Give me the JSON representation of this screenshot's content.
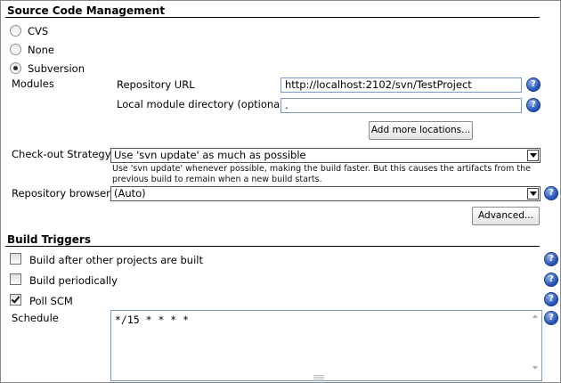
{
  "scm": {
    "title": "Source Code Management",
    "options": [
      {
        "label": "CVS",
        "checked": false
      },
      {
        "label": "None",
        "checked": false
      },
      {
        "label": "Subversion",
        "checked": true
      }
    ],
    "modules_label": "Modules",
    "repo_url_label": "Repository URL",
    "repo_url_value": "http://localhost:2102/svn/TestProject",
    "local_dir_label": "Local module directory (optional)",
    "local_dir_value": ".",
    "add_locations_button": "Add more locations...",
    "checkout_label": "Check-out Strategy",
    "checkout_value": "Use 'svn update' as much as possible",
    "checkout_description": "Use 'svn update' whenever possible, making the build faster. But this causes the artifacts from the previous build to remain when a new build starts.",
    "repo_browser_label": "Repository browser",
    "repo_browser_value": "(Auto)",
    "advanced_button": "Advanced..."
  },
  "triggers": {
    "title": "Build Triggers",
    "options": [
      {
        "label": "Build after other projects are built",
        "checked": false
      },
      {
        "label": "Build periodically",
        "checked": false
      },
      {
        "label": "Poll SCM",
        "checked": true
      }
    ],
    "schedule_label": "Schedule",
    "schedule_value": "*/15 * * * *"
  },
  "icons": {
    "help": "help-icon",
    "dropdown": "chevron-down-icon"
  },
  "help_glyph": "?",
  "colors": {
    "help_icon": "#1f4fb5",
    "input_border": "#7a9cc8"
  }
}
